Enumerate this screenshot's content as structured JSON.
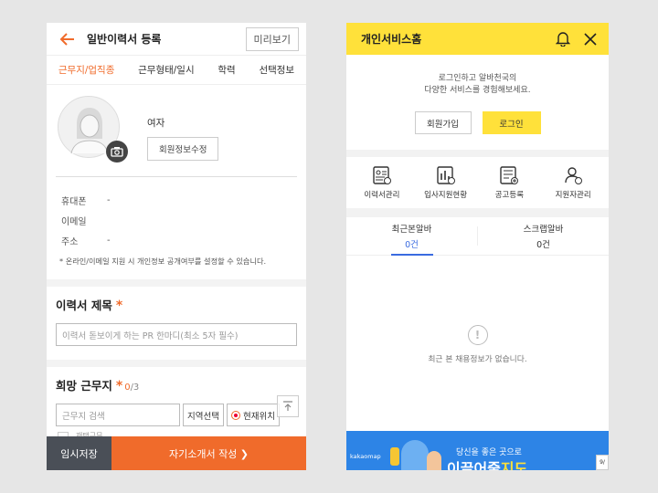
{
  "left": {
    "header": {
      "title": "일반이력서 등록",
      "preview": "미리보기"
    },
    "tabs": [
      {
        "label": "근무지/업직종",
        "active": true
      },
      {
        "label": "근무형태/일시",
        "active": false
      },
      {
        "label": "학력",
        "active": false
      },
      {
        "label": "선택정보",
        "active": false
      }
    ],
    "profile": {
      "gender": "여자",
      "edit_button": "회원정보수정"
    },
    "contacts": [
      {
        "label": "휴대폰",
        "value": "-"
      },
      {
        "label": "이메일",
        "value": ""
      },
      {
        "label": "주소",
        "value": "-"
      }
    ],
    "note": "* 온라인/이메일 지원 시 개인정보 공개여부를 설정할 수 있습니다.",
    "resume_title": {
      "heading": "이력서 제목",
      "required": "*",
      "placeholder": "이력서 돋보이게 하는 PR 한마디(최소 5자 필수)"
    },
    "work_area": {
      "heading": "희망 근무지",
      "required": "*",
      "count_current": "0",
      "count_total": "/3",
      "search_placeholder": "근무지 검색",
      "region_button": "지역선택",
      "current_location_button": "현재위치"
    },
    "checkbox_label": "재택근무",
    "bottom": {
      "temp_save": "임시저장",
      "next": "자기소개서 작성 ❯"
    },
    "accent_color": "#f06b2b"
  },
  "right": {
    "header": {
      "title": "개인서비스홈"
    },
    "intro": [
      "로그인하고 알바천국의",
      "다양한 서비스를 경험해보세요."
    ],
    "join_button": "회원가입",
    "login_button": "로그인",
    "menu": [
      {
        "label": "이력서관리",
        "icon": "resume-icon"
      },
      {
        "label": "입사지원현황",
        "icon": "chart-icon"
      },
      {
        "label": "공고등록",
        "icon": "post-icon"
      },
      {
        "label": "지원자관리",
        "icon": "applicant-icon"
      }
    ],
    "tabs": [
      {
        "label": "최근본알바",
        "count": "0건",
        "active": true
      },
      {
        "label": "스크랩알바",
        "count": "0건",
        "active": false
      }
    ],
    "empty_message": "최근 본 채용정보가 없습니다.",
    "banner": {
      "brand": "kakaomap",
      "line1": "당신을 좋은 곳으로",
      "line2_a": "이끌어줄",
      "line2_b": "지도",
      "badge": "9/"
    },
    "accent_color": "#ffe13a"
  }
}
